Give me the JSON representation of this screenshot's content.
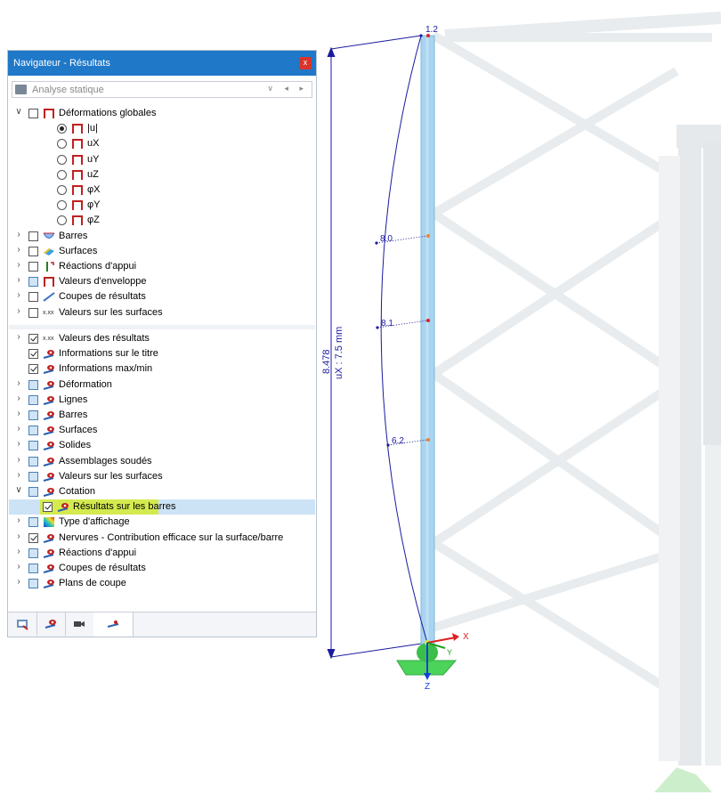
{
  "panel": {
    "title": "Navigateur - Résultats",
    "close_label": "x",
    "combo": {
      "value": "Analyse statique",
      "arrows": "∨ ◂ ▸"
    }
  },
  "tree1": [
    {
      "label": "Déformations globales",
      "name": "tree-item-deformations-globales",
      "indent": 0,
      "exp": "∨",
      "ctrl": "cb",
      "icon": "deform-icon"
    },
    {
      "label": "|u|",
      "name": "tree-item-u-abs",
      "indent": 1,
      "ctrl": "rb-on",
      "icon": "deform-icon"
    },
    {
      "label": "uX",
      "name": "tree-item-ux",
      "indent": 1,
      "ctrl": "rb",
      "icon": "deform-icon"
    },
    {
      "label": "uY",
      "name": "tree-item-uy",
      "indent": 1,
      "ctrl": "rb",
      "icon": "deform-icon"
    },
    {
      "label": "uZ",
      "name": "tree-item-uz",
      "indent": 1,
      "ctrl": "rb",
      "icon": "deform-icon"
    },
    {
      "label": "φX",
      "name": "tree-item-phix",
      "indent": 1,
      "ctrl": "rb",
      "icon": "deform-icon"
    },
    {
      "label": "φY",
      "name": "tree-item-phiy",
      "indent": 1,
      "ctrl": "rb",
      "icon": "deform-icon"
    },
    {
      "label": "φZ",
      "name": "tree-item-phiz",
      "indent": 1,
      "ctrl": "rb",
      "icon": "deform-icon"
    },
    {
      "label": "Barres",
      "name": "tree-item-barres",
      "indent": 0,
      "exp": "›",
      "ctrl": "cb",
      "icon": "member-icon"
    },
    {
      "label": "Surfaces",
      "name": "tree-item-surfaces",
      "indent": 0,
      "exp": "›",
      "ctrl": "cb",
      "icon": "surface-icon"
    },
    {
      "label": "Réactions d'appui",
      "name": "tree-item-reactions-appui",
      "indent": 0,
      "exp": "›",
      "ctrl": "cb",
      "icon": "support-icon"
    },
    {
      "label": "Valeurs d'enveloppe",
      "name": "tree-item-valeurs-enveloppe",
      "indent": 0,
      "exp": "›",
      "ctrl": "cb-blue",
      "icon": "deform-icon"
    },
    {
      "label": "Coupes de résultats",
      "name": "tree-item-coupes-resultats",
      "indent": 0,
      "exp": "›",
      "ctrl": "cb",
      "icon": "section-icon"
    },
    {
      "label": "Valeurs sur les surfaces",
      "name": "tree-item-valeurs-surfaces",
      "indent": 0,
      "exp": "›",
      "ctrl": "cb",
      "icon": "values-icon"
    }
  ],
  "tree2": [
    {
      "label": "Valeurs des résultats",
      "name": "tree-item-valeurs-resultats",
      "indent": 0,
      "exp": "›",
      "ctrl": "cb-checked",
      "icon": "values-icon"
    },
    {
      "label": "Informations sur le titre",
      "name": "tree-item-informations-titre",
      "indent": 0,
      "ctrl": "cb-checked",
      "icon": "eye-icon"
    },
    {
      "label": "Informations max/min",
      "name": "tree-item-informations-maxmin",
      "indent": 0,
      "ctrl": "cb-checked",
      "icon": "eye-icon"
    },
    {
      "label": "Déformation",
      "name": "tree-item-deformation",
      "indent": 0,
      "exp": "›",
      "ctrl": "cb-blue",
      "icon": "eye-icon"
    },
    {
      "label": "Lignes",
      "name": "tree-item-lignes",
      "indent": 0,
      "exp": "›",
      "ctrl": "cb-blue",
      "icon": "eye-icon"
    },
    {
      "label": "Barres",
      "name": "tree-item-barres-display",
      "indent": 0,
      "exp": "›",
      "ctrl": "cb-blue",
      "icon": "eye-icon"
    },
    {
      "label": "Surfaces",
      "name": "tree-item-surfaces-display",
      "indent": 0,
      "exp": "›",
      "ctrl": "cb-blue",
      "icon": "eye-icon"
    },
    {
      "label": "Solides",
      "name": "tree-item-solides",
      "indent": 0,
      "exp": "›",
      "ctrl": "cb-blue",
      "icon": "eye-icon"
    },
    {
      "label": "Assemblages soudés",
      "name": "tree-item-assemblages-soudes",
      "indent": 0,
      "exp": "›",
      "ctrl": "cb-blue",
      "icon": "eye-icon"
    },
    {
      "label": "Valeurs sur les surfaces",
      "name": "tree-item-valeurs-surfaces-display",
      "indent": 0,
      "exp": "›",
      "ctrl": "cb-blue",
      "icon": "eye-icon"
    },
    {
      "label": "Cotation",
      "name": "tree-item-cotation",
      "indent": 0,
      "exp": "∨",
      "ctrl": "cb-blue",
      "icon": "eye-icon"
    },
    {
      "label": "Résultats sur les barres",
      "name": "tree-item-resultats-barres",
      "indent": 1,
      "ctrl": "cb-checked",
      "icon": "eye-icon",
      "selected": true
    },
    {
      "label": "Type d'affichage",
      "name": "tree-item-type-affichage",
      "indent": 0,
      "exp": "›",
      "ctrl": "cb-blue",
      "icon": "colormap-icon"
    },
    {
      "label": "Nervures - Contribution efficace sur la surface/barre",
      "name": "tree-item-nervures",
      "indent": 0,
      "exp": "›",
      "ctrl": "cb-checked",
      "icon": "eye-icon"
    },
    {
      "label": "Réactions d'appui",
      "name": "tree-item-reactions-appui-display",
      "indent": 0,
      "exp": "›",
      "ctrl": "cb-blue",
      "icon": "eye-icon"
    },
    {
      "label": "Coupes de résultats",
      "name": "tree-item-coupes-resultats-display",
      "indent": 0,
      "exp": "›",
      "ctrl": "cb-blue",
      "icon": "eye-icon"
    },
    {
      "label": "Plans de coupe",
      "name": "tree-item-plans-coupe",
      "indent": 0,
      "exp": "›",
      "ctrl": "cb-blue",
      "icon": "eye-icon"
    }
  ],
  "bottom_tabs": [
    {
      "name": "tab-data-icon",
      "icon": "data-icon"
    },
    {
      "name": "tab-view-icon",
      "icon": "eye-icon"
    },
    {
      "name": "tab-camera-icon",
      "icon": "camera-icon"
    },
    {
      "name": "tab-results-icon",
      "icon": "results-icon"
    }
  ],
  "viewport": {
    "top_label": "1.2",
    "value_labels": [
      "8.0",
      "8.1",
      "6.2"
    ],
    "length_label": "8.478",
    "dim_label": "uX : 7.5 mm",
    "axes": {
      "x": "X",
      "y": "Y",
      "z": "Z"
    },
    "colors": {
      "member": "#a9d4ef",
      "member_dark": "#7fb8e0",
      "curve": "#1a1aa0",
      "grid": "#e9ecee",
      "support": "#4cd35a",
      "axis_x": "#e02020",
      "axis_y": "#20a020",
      "axis_z": "#1040e0",
      "point_red": "#e02020",
      "point_orange": "#f08030",
      "highlight": "#d4ea4f"
    }
  }
}
